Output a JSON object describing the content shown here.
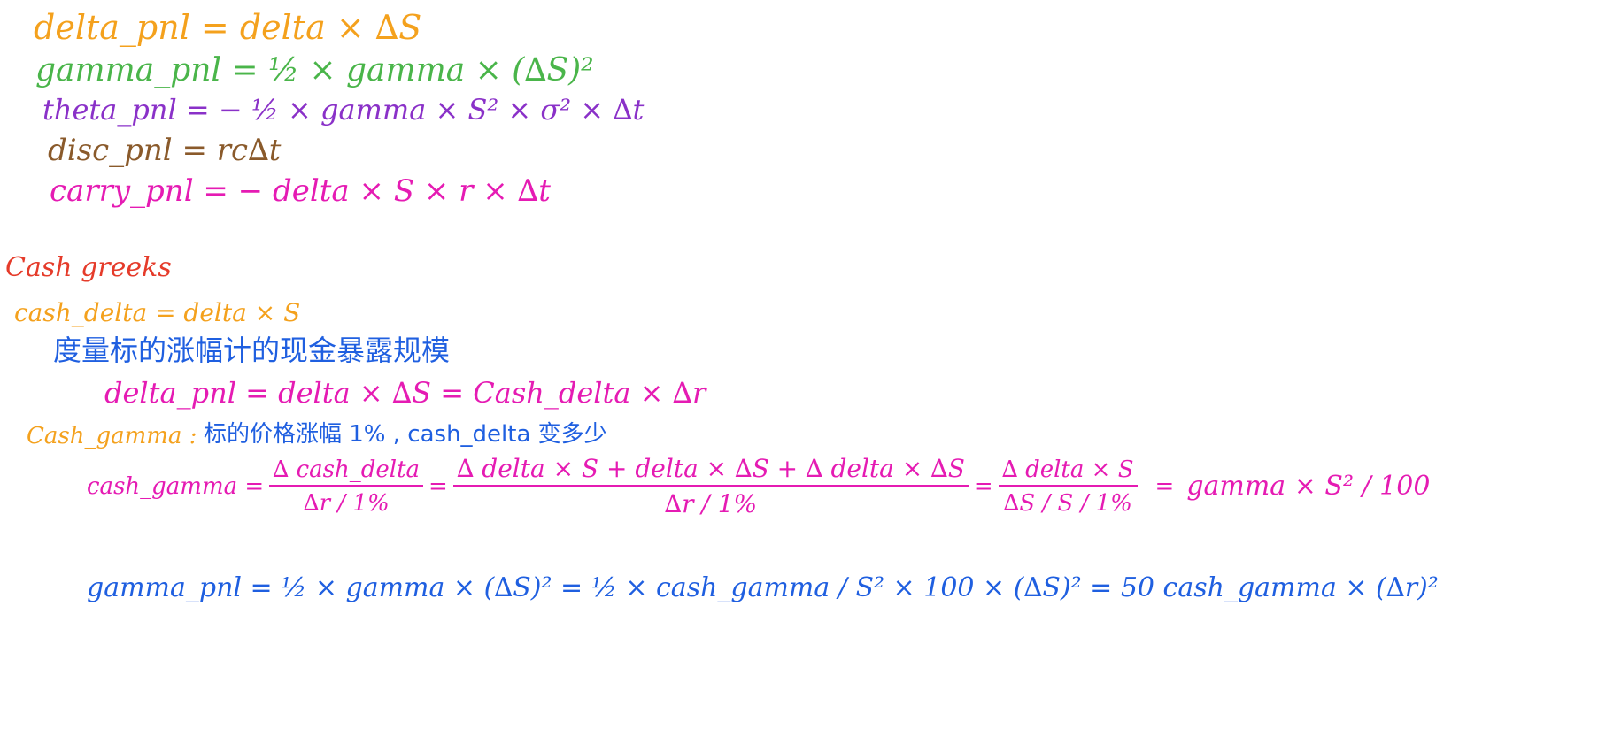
{
  "lines": {
    "delta_pnl": "delta_pnl =   delta × ∆S",
    "gamma_pnl": "gamma_pnl =   ½ × gamma × (∆S)²",
    "theta_pnl": "theta_pnl =  − ½ × gamma × S² × σ² × ∆t",
    "disc_pnl": "disc_pnl =   rc∆t",
    "carry_pnl": "carry_pnl =  − delta × S × r × ∆t",
    "cash_greeks": "Cash greeks",
    "cash_delta": "cash_delta = delta × S",
    "cn_measure": "度量标的涨幅计的现金暴露规模",
    "delta_pnl2": "delta_pnl = delta × ∆S  =  Cash_delta × ∆r",
    "cash_gamma_label": "Cash_gamma :",
    "cn_gamma": "标的价格涨幅 1% , cash_delta 变多少"
  },
  "cash_gamma_eq": {
    "lhs": "cash_gamma =",
    "f1_num": "∆ cash_delta",
    "f1_den": "∆r / 1%",
    "eq1": "=",
    "f2_num": "∆ delta × S +  delta × ∆S + ∆ delta × ∆S",
    "f2_den": "∆r / 1%",
    "eq2": "=",
    "f3_num": "∆ delta × S",
    "f3_den": "∆S / S / 1%",
    "eq3": "=",
    "rhs": "gamma × S² / 100"
  },
  "gamma_pnl_eq": {
    "text": "gamma_pnl = ½ × gamma × (∆S)²  =  ½ × cash_gamma / S² × 100 × (∆S)² = 50 cash_gamma × (∆r)²"
  }
}
